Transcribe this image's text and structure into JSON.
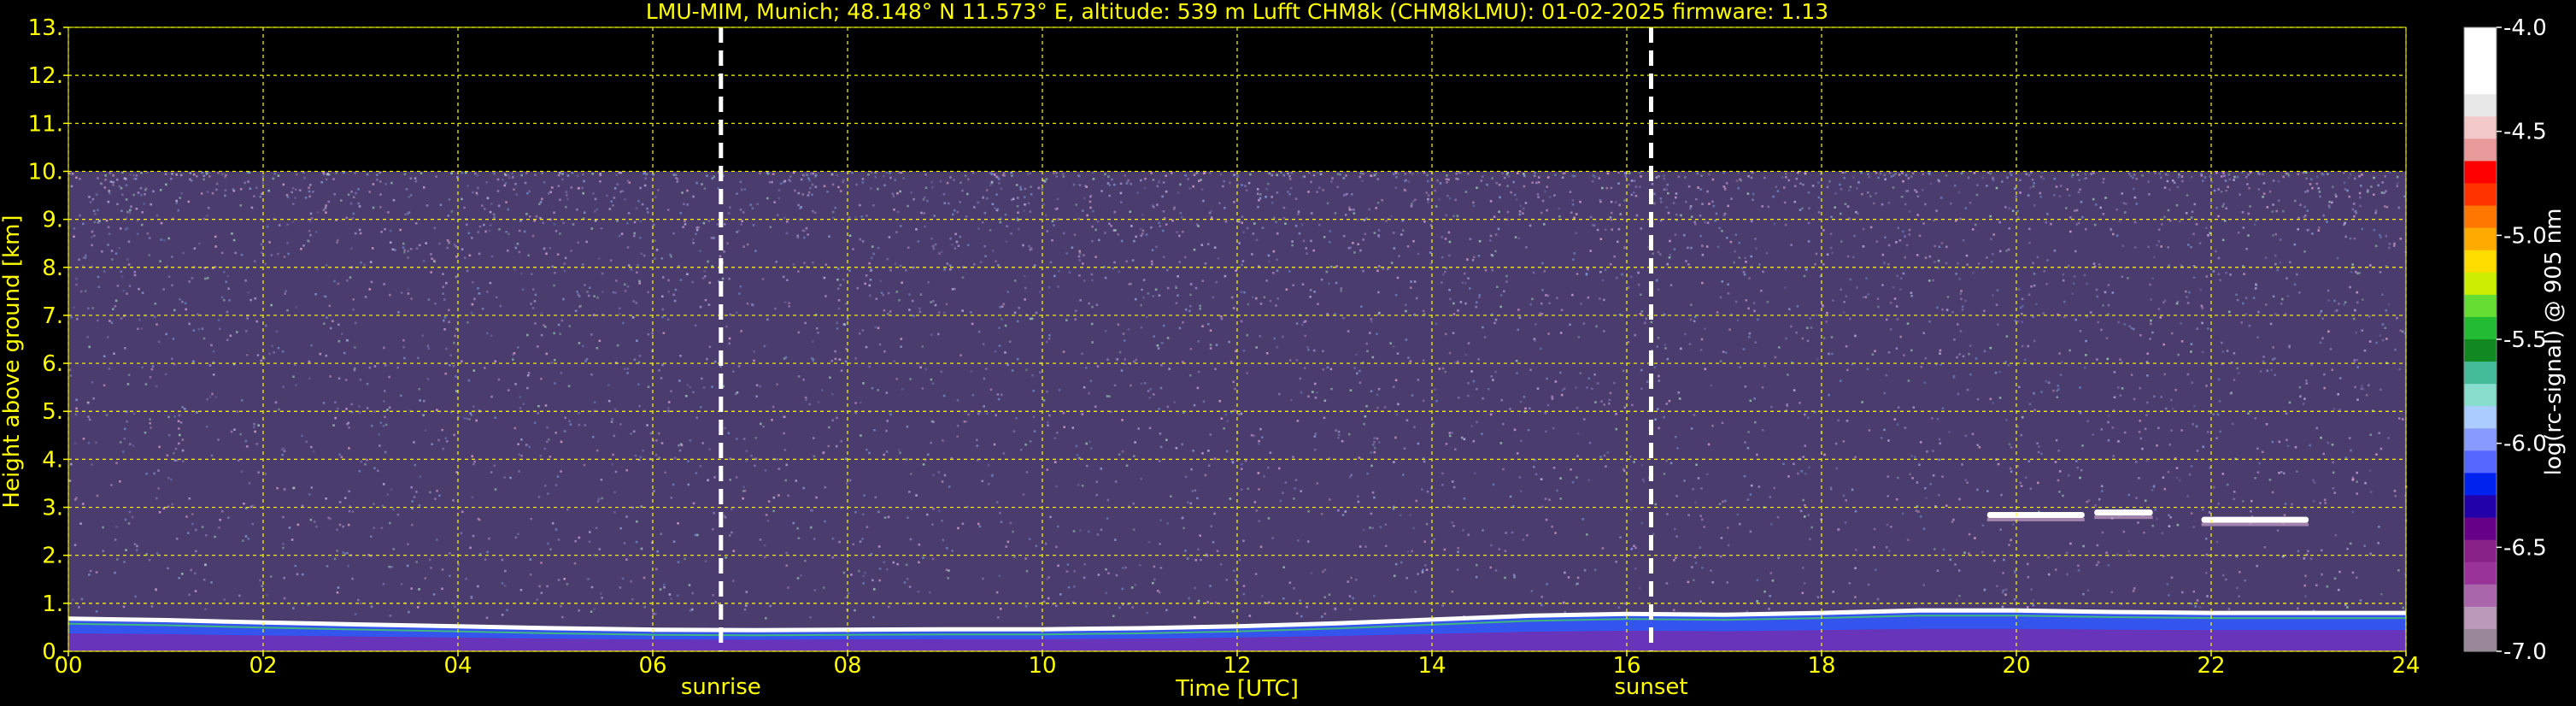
{
  "chart_data": {
    "type": "heatmap",
    "title": "LMU-MIM, Munich; 48.148° N 11.573° E, altitude: 539 m    Lufft CHM8k (CHM8kLMU): 01-02-2025    firmware: 1.13",
    "xlabel": "Time [UTC]",
    "ylabel": "Height above ground [km]",
    "xlim": [
      0,
      24
    ],
    "ylim": [
      0,
      13
    ],
    "x_ticks": [
      "00",
      "02",
      "04",
      "06",
      "08",
      "10",
      "12",
      "14",
      "16",
      "18",
      "20",
      "22",
      "24"
    ],
    "y_ticks": [
      "0.",
      "1.",
      "2.",
      "3.",
      "4.",
      "5.",
      "6.",
      "7.",
      "8.",
      "9.",
      "10.",
      "11.",
      "12.",
      "13."
    ],
    "grid": true,
    "grid_color": "#ffff00",
    "text_color": "#ffff00",
    "background_color": "#000000",
    "signal_top_km": 10.0,
    "markers": [
      {
        "label": "sunrise",
        "x": 6.7
      },
      {
        "label": "sunset",
        "x": 16.25
      }
    ],
    "boundary_layer": [
      {
        "x": 0,
        "y": 0.68
      },
      {
        "x": 1,
        "y": 0.65
      },
      {
        "x": 2,
        "y": 0.6
      },
      {
        "x": 3,
        "y": 0.56
      },
      {
        "x": 4,
        "y": 0.52
      },
      {
        "x": 5,
        "y": 0.48
      },
      {
        "x": 6,
        "y": 0.45
      },
      {
        "x": 7,
        "y": 0.44
      },
      {
        "x": 8,
        "y": 0.45
      },
      {
        "x": 9,
        "y": 0.46
      },
      {
        "x": 10,
        "y": 0.46
      },
      {
        "x": 11,
        "y": 0.48
      },
      {
        "x": 12,
        "y": 0.52
      },
      {
        "x": 13,
        "y": 0.58
      },
      {
        "x": 14,
        "y": 0.66
      },
      {
        "x": 15,
        "y": 0.74
      },
      {
        "x": 16,
        "y": 0.78
      },
      {
        "x": 17,
        "y": 0.76
      },
      {
        "x": 18,
        "y": 0.8
      },
      {
        "x": 19,
        "y": 0.85
      },
      {
        "x": 20,
        "y": 0.85
      },
      {
        "x": 21,
        "y": 0.82
      },
      {
        "x": 22,
        "y": 0.8
      },
      {
        "x": 23,
        "y": 0.8
      },
      {
        "x": 24,
        "y": 0.8
      }
    ],
    "cloud_layers": [
      {
        "x_start": 19.7,
        "x_end": 20.7,
        "y": 2.85
      },
      {
        "x_start": 20.8,
        "x_end": 21.4,
        "y": 2.9
      },
      {
        "x_start": 21.9,
        "x_end": 23.0,
        "y": 2.75
      }
    ],
    "colorbar": {
      "label": "log(rc-signal) @ 905 nm",
      "range": [
        -7.0,
        -4.0
      ],
      "ticks": [
        "-4.0",
        "-4.5",
        "-5.0",
        "-5.5",
        "-6.0",
        "-6.5",
        "-7.0"
      ],
      "colors": [
        "#ffffff",
        "#ffffff",
        "#ffffff",
        "#e8e8e8",
        "#f2c8c8",
        "#e89a9a",
        "#ff0000",
        "#ff3300",
        "#ff7700",
        "#ffaa00",
        "#ffdd00",
        "#ccee00",
        "#66dd33",
        "#22bb33",
        "#118822",
        "#44bb99",
        "#88ddcc",
        "#aaccff",
        "#8899ff",
        "#5566ff",
        "#0022ee",
        "#2200aa",
        "#660088",
        "#882288",
        "#993399",
        "#aa66aa",
        "#bb99bb",
        "#998899"
      ]
    }
  }
}
